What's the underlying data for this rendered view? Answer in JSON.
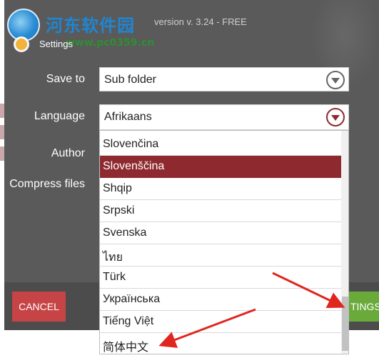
{
  "watermark": {
    "title": "河东软件园",
    "url": "www.pc0359.cn"
  },
  "header": {
    "title": "Settings",
    "version": "version v. 3.24 - FREE"
  },
  "form": {
    "save_to": {
      "label": "Save to",
      "value": "Sub folder"
    },
    "language": {
      "label": "Language",
      "value": "Afrikaans"
    },
    "author": {
      "label": "Author"
    },
    "compress": {
      "label": "Compress files"
    }
  },
  "dropdown": {
    "options": [
      "Slovenčina",
      "Slovenščina",
      "Shqip",
      "Srpski",
      "Svenska",
      "ไทย",
      "Türk",
      "Українська",
      "Tiếng Việt",
      "简体中文"
    ],
    "selected_index": 1
  },
  "footer": {
    "cancel_label": "CANCEL",
    "save_label": "TINGS"
  },
  "colors": {
    "accent": "#8e2a2f",
    "cancel": "#c74446",
    "save": "#6aaa3a",
    "arrow": "#e0261f"
  }
}
